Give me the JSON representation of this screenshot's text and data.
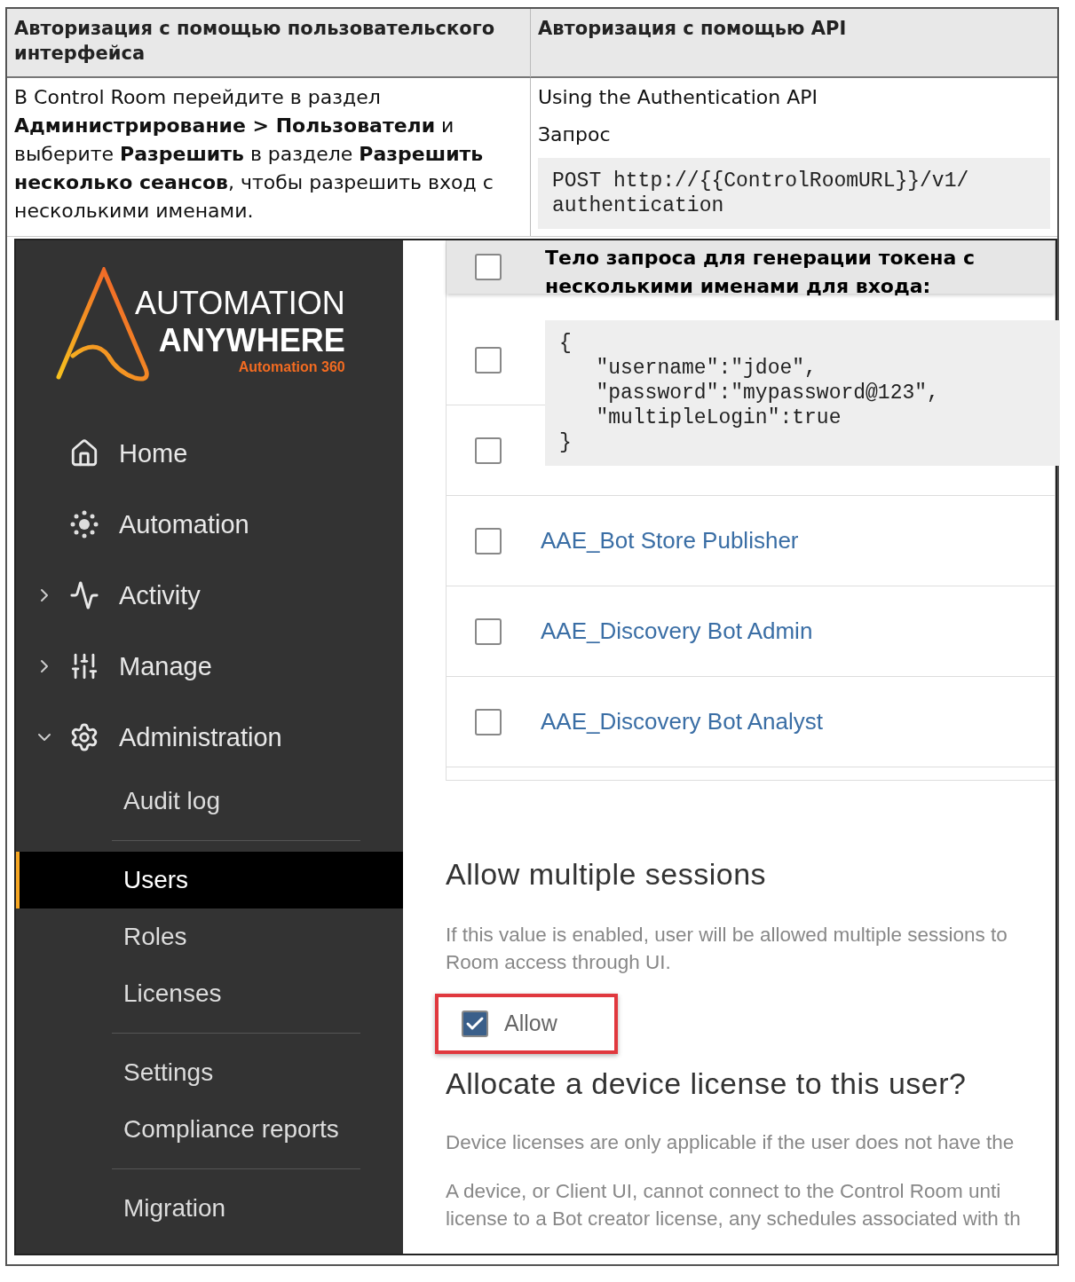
{
  "table": {
    "columns": [
      "Авторизация с помощью пользовательского интерфейса",
      "Авторизация с помощью API"
    ],
    "ui_instructions": "В Control Room перейдите в раздел **Администрирование > Пользователи** и выберите **Разрешить** в разделе **Разрешить несколько сеансов**, чтобы разрешить вход с несколькими именами.",
    "api_title": "Using the Authentication API",
    "request_label": "Запрос",
    "request_code_lines": [
      "POST http://{{ControlRoomURL}}/v1/",
      "authentication"
    ],
    "body_label": "**Тело запроса для генерации токена с несколькими именами для входа**:",
    "body_code_lines": [
      "{",
      "   \"username\":\"jdoe\",",
      "   \"password\":\"mypassword@123\",",
      "   \"multipleLogin\":true",
      "}"
    ]
  },
  "screenshot": {
    "logo": {
      "line1": "AUTOMATION",
      "line2": "ANYWHERE",
      "line3": "Automation 360"
    },
    "nav": [
      {
        "label": "Home"
      },
      {
        "label": "Automation"
      },
      {
        "label": "Activity",
        "expanded": false
      },
      {
        "label": "Manage",
        "expanded": false
      },
      {
        "label": "Administration",
        "expanded": true,
        "children_groups": [
          [
            {
              "label": "Audit log",
              "selected": false
            }
          ],
          [
            {
              "label": "Users",
              "selected": true
            },
            {
              "label": "Roles",
              "selected": false
            },
            {
              "label": "Licenses",
              "selected": false
            }
          ],
          [
            {
              "label": "Settings",
              "selected": false
            },
            {
              "label": "Compliance reports",
              "selected": false
            }
          ],
          [
            {
              "label": "Migration",
              "selected": false
            }
          ]
        ]
      }
    ],
    "users": {
      "header_checked": false,
      "rows": [
        {
          "checked": false
        },
        {
          "checked": false
        },
        {
          "name": "AAE_Bot Store Publisher",
          "checked": false
        },
        {
          "name": "AAE_Discovery Bot Admin",
          "checked": false
        },
        {
          "name": "AAE_Discovery Bot Analyst",
          "checked": false
        }
      ]
    },
    "sessions": {
      "title": "Allow multiple sessions",
      "description_lines": [
        "If this value is enabled, user will be allowed multiple sessions to",
        "Room access through UI."
      ],
      "allow": {
        "label": "Allow",
        "checked": true
      }
    },
    "license": {
      "title": "Allocate a device license to this user?",
      "paragraphs": [
        [
          "Device licenses are only applicable if the user does not have the"
        ],
        [
          "A device, or Client UI, cannot connect to the Control Room unti",
          "license to a Bot creator license, any schedules associated with th"
        ]
      ]
    }
  }
}
